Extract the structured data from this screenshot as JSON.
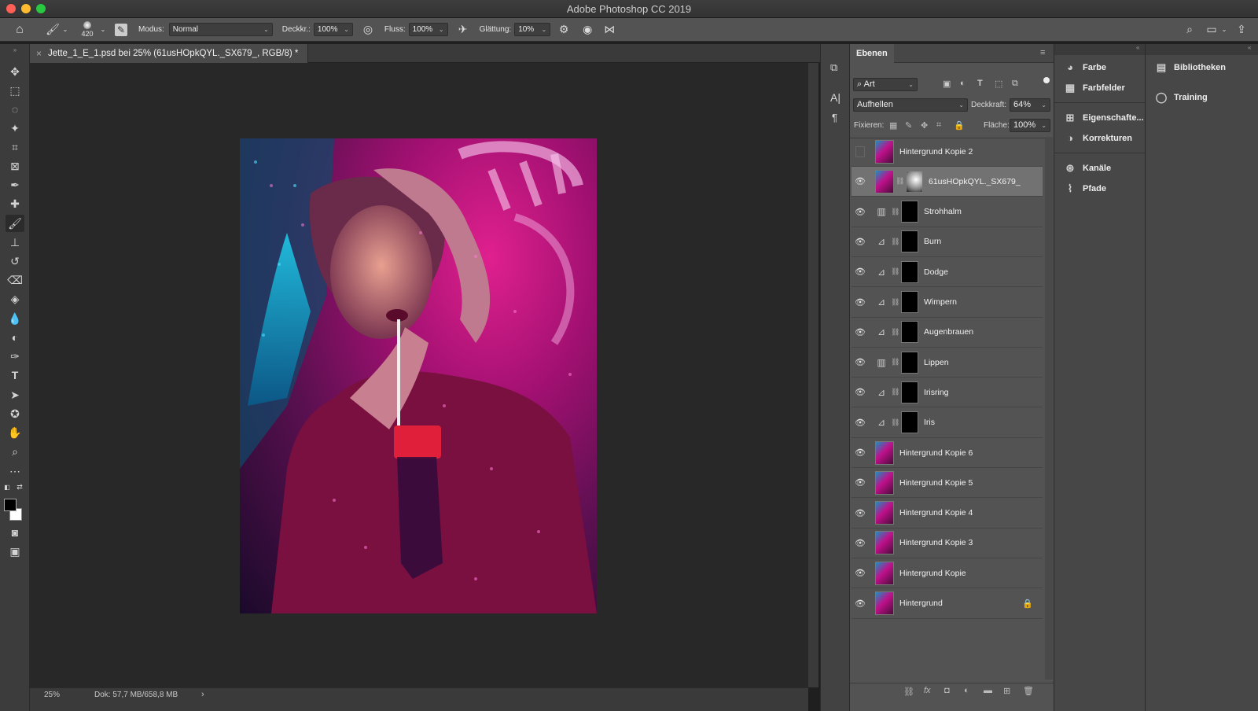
{
  "window": {
    "title": "Adobe Photoshop CC 2019"
  },
  "options_bar": {
    "brush_size": "420",
    "mode_label": "Modus:",
    "mode_value": "Normal",
    "opacity_label": "Deckkr.:",
    "opacity_value": "100%",
    "flow_label": "Fluss:",
    "flow_value": "100%",
    "smoothing_label": "Glättung:",
    "smoothing_value": "10%"
  },
  "document": {
    "tab_title": "Jette_1_E_1.psd bei 25% (61usHOpkQYL._SX679_, RGB/8) *",
    "close_glyph": "×"
  },
  "status": {
    "zoom": "25%",
    "doc_info": "Dok: 57,7 MB/658,8 MB",
    "arrow": "›"
  },
  "colors": {
    "accent": "#3a8ee6",
    "foreground": "#000000",
    "background": "#ffffff"
  },
  "layers_panel": {
    "tab_label": "Ebenen",
    "filter_value": "Art",
    "blend_mode": "Aufhellen",
    "opacity_label": "Deckkraft:",
    "opacity_value": "64%",
    "lock_label": "Fixieren:",
    "fill_label": "Fläche:",
    "fill_value": "100%",
    "layers": [
      {
        "name": "Hintergrund Kopie 2",
        "visible": false,
        "kind": "photo"
      },
      {
        "name": "61usHOpkQYL._SX679_",
        "visible": true,
        "kind": "smart",
        "selected": true
      },
      {
        "name": "Strohhalm",
        "visible": true,
        "kind": "adj-levels"
      },
      {
        "name": "Burn",
        "visible": true,
        "kind": "adj-curves"
      },
      {
        "name": "Dodge",
        "visible": true,
        "kind": "adj-curves"
      },
      {
        "name": "Wimpern",
        "visible": true,
        "kind": "adj-curves"
      },
      {
        "name": "Augenbrauen",
        "visible": true,
        "kind": "adj-curves"
      },
      {
        "name": "Lippen",
        "visible": true,
        "kind": "adj-levels"
      },
      {
        "name": "Irisring",
        "visible": true,
        "kind": "adj-curves"
      },
      {
        "name": "Iris",
        "visible": true,
        "kind": "adj-curves"
      },
      {
        "name": "Hintergrund Kopie 6",
        "visible": true,
        "kind": "photo"
      },
      {
        "name": "Hintergrund Kopie 5",
        "visible": true,
        "kind": "photo"
      },
      {
        "name": "Hintergrund Kopie 4",
        "visible": true,
        "kind": "photo"
      },
      {
        "name": "Hintergrund Kopie 3",
        "visible": true,
        "kind": "photo"
      },
      {
        "name": "Hintergrund Kopie",
        "visible": true,
        "kind": "photo"
      },
      {
        "name": "Hintergrund",
        "visible": true,
        "kind": "photo",
        "locked": true
      }
    ]
  },
  "dock": {
    "col1": [
      "Farbe",
      "Farbfelder",
      "Eigenschafte...",
      "Korrekturen",
      "Kanäle",
      "Pfade"
    ],
    "col2": [
      "Bibliotheken",
      "Training"
    ]
  }
}
